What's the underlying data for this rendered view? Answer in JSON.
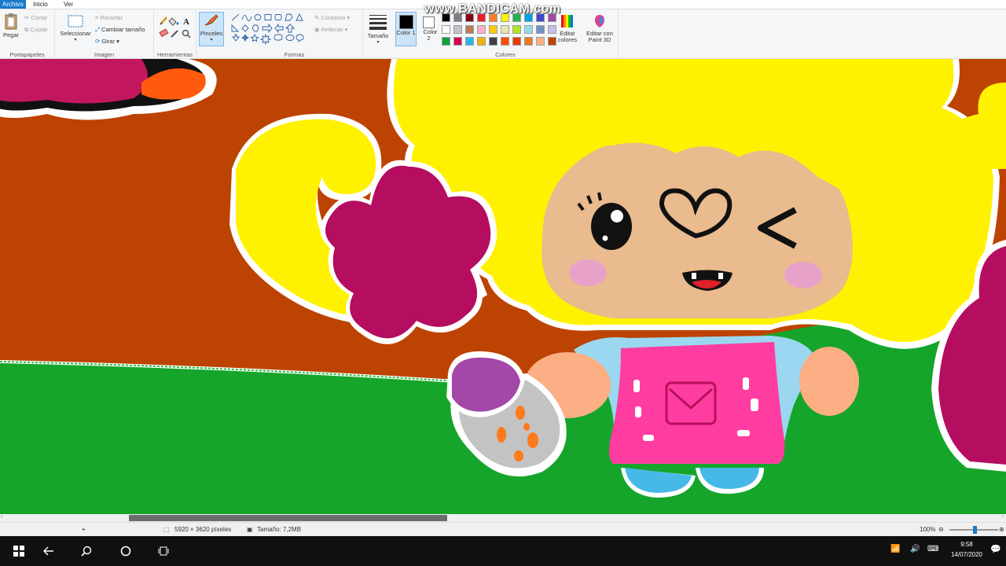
{
  "tabs": [
    "Archivo",
    "Inicio",
    "Ver"
  ],
  "watermark": "www.BANDICAM.com",
  "ribbon": {
    "portapapeles": {
      "label": "Portapapeles",
      "pegar": "Pegar",
      "cortar": "Cortar",
      "copiar": "Copiar"
    },
    "imagen": {
      "label": "Imagen",
      "seleccionar": "Seleccionar",
      "recortar": "Recortar",
      "cambiar_tamano": "Cambiar tamaño",
      "girar": "Girar"
    },
    "herramientas": {
      "label": "Herramientas"
    },
    "pinceles": "Pinceles",
    "formas": {
      "label": "Formas",
      "contorno": "Contorno",
      "rellenar": "Rellenar"
    },
    "tamano": "Tamaño",
    "colores": {
      "label": "Colores",
      "color1": "Color 1",
      "color2": "Color 2",
      "editar_colores": "Editar colores",
      "editar_paint3d": "Editar con Paint 3D",
      "palette": [
        "#000000",
        "#7f7f7f",
        "#880015",
        "#ed1c24",
        "#ff7f27",
        "#fff200",
        "#22b14c",
        "#00a2e8",
        "#3f48cc",
        "#a349a4",
        "#ffffff",
        "#c3c3c3",
        "#b97a57",
        "#ffaec9",
        "#ffc90e",
        "#efe4b0",
        "#b5e61d",
        "#99d9ea",
        "#7092be",
        "#c8bfe7",
        "#0fa03c",
        "#d9004c",
        "#2ab5e8",
        "#f2b400",
        "#404040",
        "#ff4a00",
        "#ee3a00",
        "#f07820",
        "#ffb080",
        "#c24400"
      ],
      "color1_value": "#000000",
      "color2_value": "#ffffff"
    }
  },
  "status": {
    "dimensions": "5920 × 3620 píxeles",
    "size": "Tamaño: 7,2MB",
    "zoom": "100%"
  },
  "clock": {
    "time": "9:58",
    "date": "14/07/2020"
  }
}
